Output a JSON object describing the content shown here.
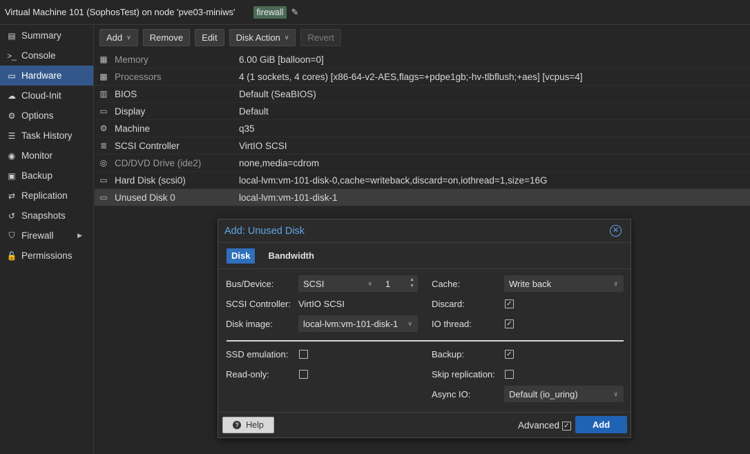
{
  "header": {
    "title": "Virtual Machine 101 (SophosTest) on node 'pve03-miniws'",
    "tag": "firewall"
  },
  "sidebar": {
    "items": [
      {
        "label": "Summary",
        "icon": "book-icon",
        "glyph": "▤"
      },
      {
        "label": "Console",
        "icon": "terminal-icon",
        "glyph": ">_"
      },
      {
        "label": "Hardware",
        "icon": "monitor-icon",
        "glyph": "▭",
        "active": true
      },
      {
        "label": "Cloud-Init",
        "icon": "cloud-icon",
        "glyph": "☁"
      },
      {
        "label": "Options",
        "icon": "gear-icon",
        "glyph": "⚙"
      },
      {
        "label": "Task History",
        "icon": "list-icon",
        "glyph": "☰"
      },
      {
        "label": "Monitor",
        "icon": "eye-icon",
        "glyph": "◉"
      },
      {
        "label": "Backup",
        "icon": "save-icon",
        "glyph": "▣"
      },
      {
        "label": "Replication",
        "icon": "retweet-icon",
        "glyph": "⇄"
      },
      {
        "label": "Snapshots",
        "icon": "history-icon",
        "glyph": "↺"
      },
      {
        "label": "Firewall",
        "icon": "shield-icon",
        "glyph": "⛉"
      },
      {
        "label": "Permissions",
        "icon": "unlock-icon",
        "glyph": "🔓"
      }
    ]
  },
  "toolbar": {
    "add_label": "Add",
    "remove_label": "Remove",
    "edit_label": "Edit",
    "disk_action_label": "Disk Action",
    "revert_label": "Revert"
  },
  "hardware": [
    {
      "name": "Memory",
      "value": "6.00 GiB [balloon=0]",
      "icon": "memory-icon",
      "glyph": "▦",
      "muted": true
    },
    {
      "name": "Processors",
      "value": "4 (1 sockets, 4 cores) [x86-64-v2-AES,flags=+pdpe1gb;-hv-tlbflush;+aes] [vcpus=4]",
      "icon": "cpu-icon",
      "glyph": "▩",
      "muted": true
    },
    {
      "name": "BIOS",
      "value": "Default (SeaBIOS)",
      "icon": "microchip-icon",
      "glyph": "▥"
    },
    {
      "name": "Display",
      "value": "Default",
      "icon": "desktop-icon",
      "glyph": "▭"
    },
    {
      "name": "Machine",
      "value": "q35",
      "icon": "cogs-icon",
      "glyph": "⚙"
    },
    {
      "name": "SCSI Controller",
      "value": "VirtIO SCSI",
      "icon": "database-icon",
      "glyph": "≣"
    },
    {
      "name": "CD/DVD Drive (ide2)",
      "value": "none,media=cdrom",
      "icon": "cdrom-icon",
      "glyph": "◎",
      "muted": true
    },
    {
      "name": "Hard Disk (scsi0)",
      "value": "local-lvm:vm-101-disk-0,cache=writeback,discard=on,iothread=1,size=16G",
      "icon": "hdd-icon",
      "glyph": "▭"
    },
    {
      "name": "Unused Disk 0",
      "value": "local-lvm:vm-101-disk-1",
      "icon": "hdd-icon",
      "glyph": "▭",
      "selected": true
    }
  ],
  "dialog": {
    "title": "Add: Unused Disk",
    "tabs": [
      "Disk",
      "Bandwidth"
    ],
    "bus_device_label": "Bus/Device:",
    "bus_value": "SCSI",
    "device_number": "1",
    "scsi_controller_label": "SCSI Controller:",
    "scsi_controller_value": "VirtIO SCSI",
    "disk_image_label": "Disk image:",
    "disk_image_value": "local-lvm:vm-101-disk-1",
    "cache_label": "Cache:",
    "cache_value": "Write back",
    "discard_label": "Discard:",
    "discard_checked": true,
    "io_thread_label": "IO thread:",
    "io_thread_checked": true,
    "ssd_label": "SSD emulation:",
    "ssd_checked": false,
    "readonly_label": "Read-only:",
    "readonly_checked": false,
    "backup_label": "Backup:",
    "backup_checked": true,
    "skip_replication_label": "Skip replication:",
    "skip_replication_checked": false,
    "async_io_label": "Async IO:",
    "async_io_value": "Default (io_uring)",
    "help_label": "Help",
    "advanced_label": "Advanced",
    "advanced_checked": true,
    "add_label": "Add"
  },
  "colors": {
    "accent": "#1f63b4",
    "title_blue": "#5fa6e6",
    "selected_nav": "#33578a",
    "tag_green": "#4a6b55"
  }
}
